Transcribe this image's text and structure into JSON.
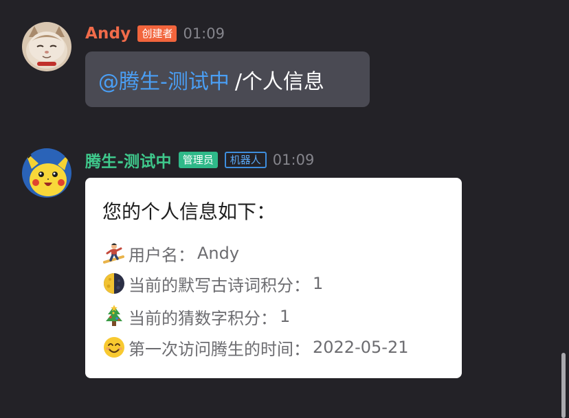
{
  "messages": [
    {
      "sender": "Andy",
      "role_badge": "创建者",
      "time": "01:09",
      "mention": "@腾生-测试中",
      "command": "/个人信息",
      "avatar": "cat-photo-avatar"
    },
    {
      "sender": "腾生-测试中",
      "role_badge": "管理员",
      "bot_badge": "机器人",
      "time": "01:09",
      "avatar": "pikachu-avatar",
      "card": {
        "title": "您的个人信息如下：",
        "lines": [
          {
            "icon": "snowboarder-emoji",
            "label": "用户名：",
            "value": "Andy"
          },
          {
            "icon": "half-moon-emoji",
            "label": "当前的默写古诗词积分：",
            "value": "1"
          },
          {
            "icon": "christmas-tree-emoji",
            "label": "当前的猜数字积分：",
            "value": "1"
          },
          {
            "icon": "smiling-face-emoji",
            "label": "第一次访问腾生的时间：",
            "value": "2022-05-21"
          }
        ]
      }
    }
  ],
  "colors": {
    "background": "#232227",
    "andy_name": "#f16b4a",
    "creator_badge": "#f2653d",
    "bot_name": "#3fc98c",
    "admin_badge": "#2fb989",
    "bot_badge_border": "#3e8ede",
    "mention": "#4a9ff5",
    "bubble": "#4a4a53",
    "time": "#85858c"
  }
}
